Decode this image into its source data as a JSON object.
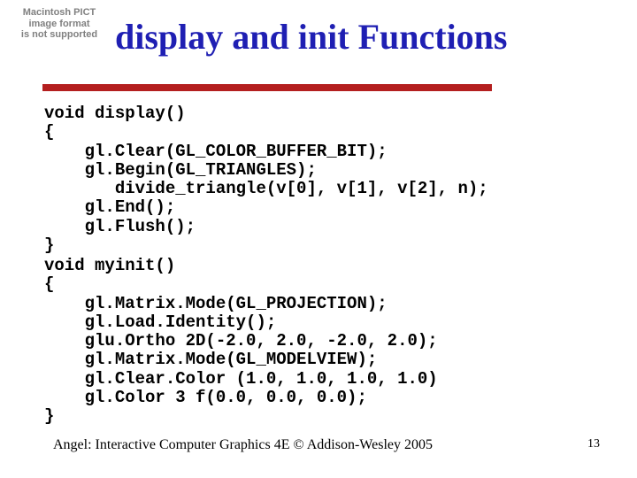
{
  "placeholder": {
    "line1": "Macintosh PICT",
    "line2": "image format",
    "line3": "is not supported"
  },
  "title": "display and init Functions",
  "code_display": "void display()\n{\n    gl.Clear(GL_COLOR_BUFFER_BIT);\n    gl.Begin(GL_TRIANGLES);\n       divide_triangle(v[0], v[1], v[2], n);\n    gl.End();\n    gl.Flush();\n}",
  "code_init": "void myinit()\n{\n    gl.Matrix.Mode(GL_PROJECTION);\n    gl.Load.Identity();\n    glu.Ortho 2D(-2.0, 2.0, -2.0, 2.0);\n    gl.Matrix.Mode(GL_MODELVIEW);\n    gl.Clear.Color (1.0, 1.0, 1.0, 1.0)\n    gl.Color 3 f(0.0, 0.0, 0.0);\n}",
  "footer": "Angel: Interactive Computer Graphics 4E © Addison-Wesley 2005",
  "page_number": "13"
}
